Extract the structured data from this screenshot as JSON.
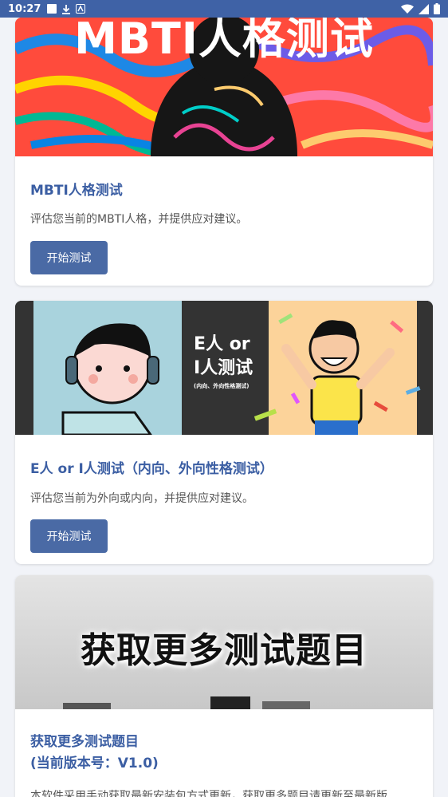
{
  "status_bar": {
    "time": "10:27"
  },
  "cards": [
    {
      "banner_title": "MBTI人格测试",
      "title": "MBTI人格测试",
      "description": "评估您当前的MBTI人格，并提供应对建议。",
      "button": "开始测试"
    },
    {
      "banner_title_1": "E人 or",
      "banner_title_2": "I人测试",
      "banner_subtitle": "(内向、外向性格测试)",
      "title": "E人 or I人测试（内向、外向性格测试）",
      "description": "评估您当前为外向或内向，并提供应对建议。",
      "button": "开始测试"
    },
    {
      "banner_title": "获取更多测试题目",
      "title_line1": "获取更多测试题目",
      "title_line2": "(当前版本号：V1.0)",
      "description": "本软件采用手动获取最新安装包方式更新，获取更多题目请更新至最新版"
    }
  ]
}
